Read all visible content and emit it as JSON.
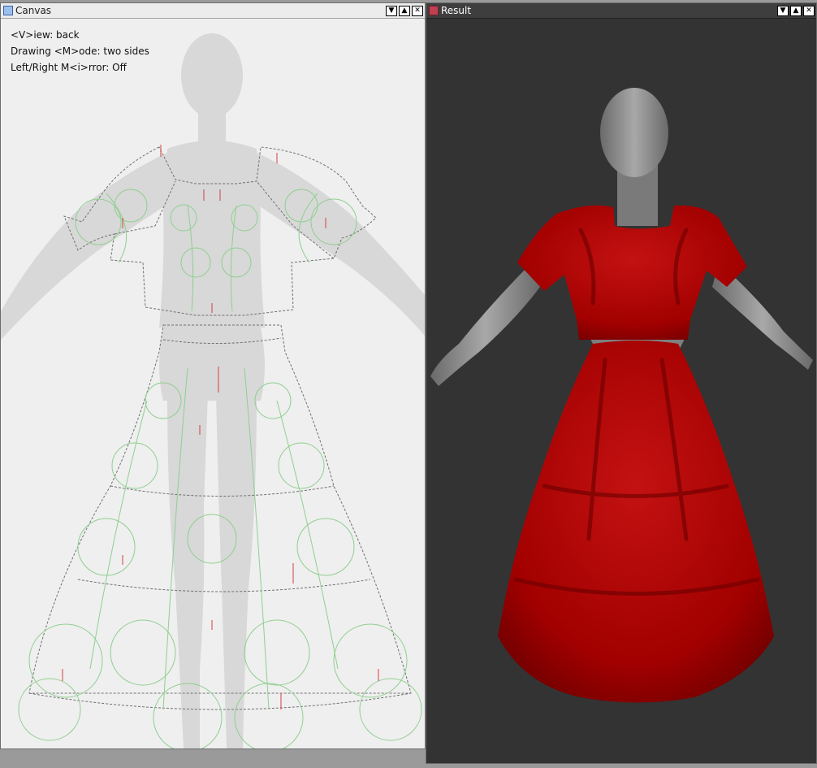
{
  "windows": {
    "canvas": {
      "title": "Canvas",
      "icon": "window-icon",
      "controls": [
        "minimize",
        "maximize",
        "close"
      ],
      "status_lines": {
        "view": "<V>iew: back",
        "mode": "Drawing <M>ode: two sides",
        "mirror": "Left/Right M<i>rror: Off"
      }
    },
    "result": {
      "title": "Result",
      "icon": "app-icon",
      "controls": [
        "minimize",
        "maximize",
        "close"
      ],
      "background_color": "#333333",
      "garment_color": "#b00000"
    }
  },
  "glyphs": {
    "minimize": "▼",
    "maximize": "▲",
    "close": "✕"
  }
}
